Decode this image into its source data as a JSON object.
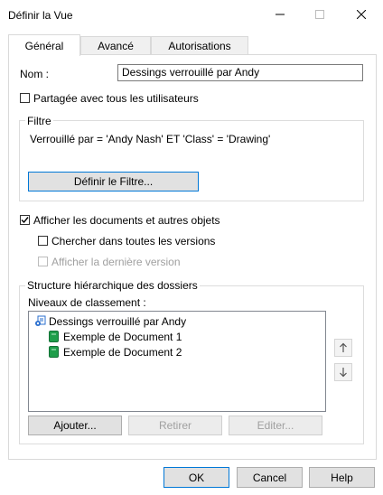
{
  "window": {
    "title": "Définir la Vue"
  },
  "tabs": [
    {
      "label": "Général"
    },
    {
      "label": "Avancé"
    },
    {
      "label": "Autorisations"
    }
  ],
  "general": {
    "name_label": "Nom :",
    "name_value": "Dessings verrouillé par Andy",
    "shared_label": "Partagée avec tous les utilisateurs",
    "shared_checked": false,
    "filter": {
      "title": "Filtre",
      "expression": "Verrouillé par = 'Andy Nash' ET 'Class' = 'Drawing'",
      "define_button": "Définir le Filtre..."
    },
    "show_docs_label": "Afficher les documents et autres objets",
    "show_docs_checked": true,
    "search_all_label": "Chercher dans toutes les versions",
    "search_all_checked": false,
    "show_last_label": "Afficher la dernière version",
    "show_last_checked": false,
    "folders": {
      "title": "Structure hiérarchique des dossiers",
      "levels_label": "Niveaux de classement :",
      "tree": {
        "root": {
          "label": "Dessings verrouillé par Andy",
          "icon": "view-icon"
        },
        "children": [
          {
            "label": "Exemple de Document 1",
            "icon": "document-icon"
          },
          {
            "label": "Exemple de Document 2",
            "icon": "document-icon"
          }
        ]
      },
      "add_button": "Ajouter...",
      "remove_button": "Retirer",
      "edit_button": "Editer..."
    }
  },
  "footer": {
    "ok": "OK",
    "cancel": "Cancel",
    "help": "Help"
  },
  "colors": {
    "accent": "#0078d7",
    "doc_green": "#1e9e4a",
    "view_blue": "#2a6fcf"
  }
}
